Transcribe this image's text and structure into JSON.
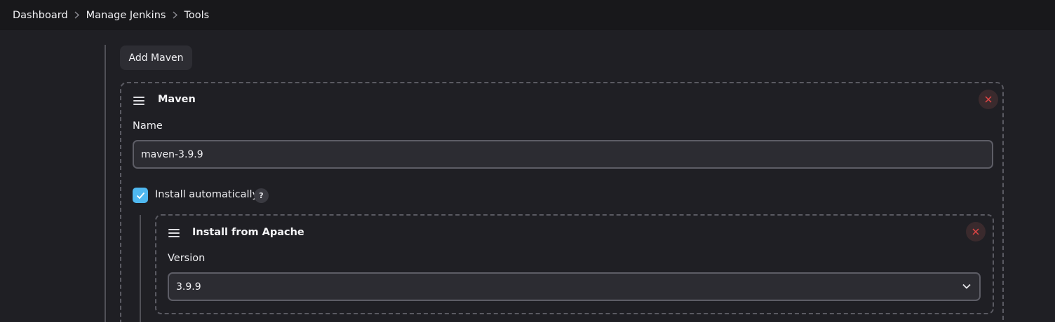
{
  "breadcrumb": {
    "items": [
      "Dashboard",
      "Manage Jenkins",
      "Tools"
    ],
    "separator_icon": "chevron-right-icon"
  },
  "actions": {
    "add_maven_label": "Add Maven"
  },
  "maven_card": {
    "title": "Maven",
    "handle_icon": "drag-handle-icon",
    "close_icon": "close-icon",
    "name_label": "Name",
    "name_value": "maven-3.9.9",
    "install_auto_label": "Install automatically",
    "install_auto_checked": true,
    "help_glyph": "?"
  },
  "installer_card": {
    "title": "Install from Apache",
    "version_label": "Version",
    "version_value": "3.9.9",
    "chevron_icon": "chevron-down-icon"
  },
  "colors": {
    "background": "#1f1f24",
    "topbar": "#18181b",
    "accent_checkbox": "#4fb8f0",
    "close_icon": "#e04545"
  }
}
